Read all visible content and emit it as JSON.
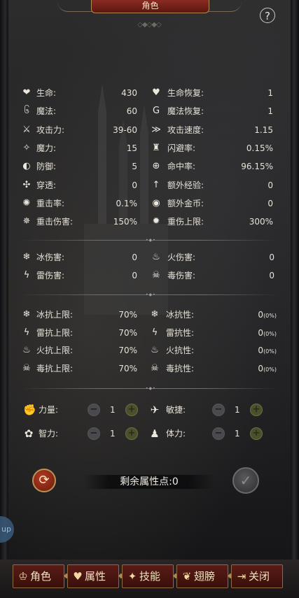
{
  "header": {
    "title": "角色",
    "help_icon": "?"
  },
  "stats": [
    {
      "icon": "heart-icon",
      "glyph": "❤",
      "label": "生命:",
      "value": "430"
    },
    {
      "icon": "life-regen-icon",
      "glyph": "♥",
      "label": "生命恢复:",
      "value": "1"
    },
    {
      "icon": "mana-swirl-icon",
      "glyph": "၆",
      "label": "魔法:",
      "value": "60"
    },
    {
      "icon": "mana-regen-icon",
      "glyph": "G",
      "label": "魔法恢复:",
      "value": "1"
    },
    {
      "icon": "sword-icon",
      "glyph": "⚔",
      "label": "攻击力:",
      "value": "39-60"
    },
    {
      "icon": "attack-speed-icon",
      "glyph": "≫",
      "label": "攻击速度:",
      "value": "1.15"
    },
    {
      "icon": "magic-power-icon",
      "glyph": "✧",
      "label": "魔力:",
      "value": "15"
    },
    {
      "icon": "dodge-icon",
      "glyph": "♜",
      "label": "闪避率:",
      "value": "0.15%"
    },
    {
      "icon": "shield-icon",
      "glyph": "◐",
      "label": "防御:",
      "value": "5"
    },
    {
      "icon": "crosshair-icon",
      "glyph": "⊕",
      "label": "命中率:",
      "value": "96.15%"
    },
    {
      "icon": "pierce-icon",
      "glyph": "✣",
      "label": "穿透:",
      "value": "0"
    },
    {
      "icon": "bonus-exp-icon",
      "glyph": "↑",
      "label": "额外经验:",
      "value": "0"
    },
    {
      "icon": "crit-rate-icon",
      "glyph": "✺",
      "label": "重击率:",
      "value": "0.1%"
    },
    {
      "icon": "bonus-gold-icon",
      "glyph": "◉",
      "label": "额外金币:",
      "value": "0"
    },
    {
      "icon": "crit-damage-icon",
      "glyph": "✵",
      "label": "重击伤害:",
      "value": "150%"
    },
    {
      "icon": "crit-cap-icon",
      "glyph": "✹",
      "label": "重伤上限:",
      "value": "300%"
    }
  ],
  "elemental_damage": [
    {
      "icon": "ice-icon",
      "glyph": "❄",
      "label": "冰伤害:",
      "value": "0"
    },
    {
      "icon": "fire-icon",
      "glyph": "♨",
      "label": "火伤害:",
      "value": "0"
    },
    {
      "icon": "lightning-icon",
      "glyph": "ϟ",
      "label": "雷伤害:",
      "value": "0"
    },
    {
      "icon": "poison-icon",
      "glyph": "☠",
      "label": "毒伤害:",
      "value": "0"
    }
  ],
  "resistances": [
    {
      "icon": "ice-cap-icon",
      "glyph": "❄",
      "label": "冰抗上限:",
      "value": "70%",
      "pct": ""
    },
    {
      "icon": "ice-resist-icon",
      "glyph": "❄",
      "label": "冰抗性:",
      "value": "0",
      "pct": "(0%)"
    },
    {
      "icon": "lightning-cap-icon",
      "glyph": "ϟ",
      "label": "雷抗上限:",
      "value": "70%",
      "pct": ""
    },
    {
      "icon": "lightning-resist-icon",
      "glyph": "ϟ",
      "label": "雷抗性:",
      "value": "0",
      "pct": "(0%)"
    },
    {
      "icon": "fire-cap-icon",
      "glyph": "♨",
      "label": "火抗上限:",
      "value": "70%",
      "pct": ""
    },
    {
      "icon": "fire-resist-icon",
      "glyph": "♨",
      "label": "火抗性:",
      "value": "0",
      "pct": "(0%)"
    },
    {
      "icon": "poison-cap-icon",
      "glyph": "☠",
      "label": "毒抗上限:",
      "value": "70%",
      "pct": ""
    },
    {
      "icon": "poison-resist-icon",
      "glyph": "☠",
      "label": "毒抗性:",
      "value": "0",
      "pct": "(0%)"
    }
  ],
  "attributes": [
    {
      "icon": "strength-icon",
      "glyph": "✊",
      "label": "力量:",
      "value": "1",
      "minus": "−",
      "plus": "+"
    },
    {
      "icon": "agility-icon",
      "glyph": "✈",
      "label": "敏捷:",
      "value": "1",
      "minus": "−",
      "plus": "+"
    },
    {
      "icon": "intellect-icon",
      "glyph": "✿",
      "label": "智力:",
      "value": "1",
      "minus": "−",
      "plus": "+"
    },
    {
      "icon": "stamina-icon",
      "glyph": "♟",
      "label": "体力:",
      "value": "1",
      "minus": "−",
      "plus": "+"
    }
  ],
  "actions": {
    "reset_glyph": "⟳",
    "remaining_points": "剩余属性点:0",
    "confirm_glyph": "✓",
    "side_badge": "up"
  },
  "tabs": [
    {
      "icon": "character-tab-icon",
      "glyph": "♔",
      "label": "角色"
    },
    {
      "icon": "attributes-tab-icon",
      "glyph": "♥",
      "label": "属性"
    },
    {
      "icon": "skills-tab-icon",
      "glyph": "✦",
      "label": "技能"
    },
    {
      "icon": "wings-tab-icon",
      "glyph": "❦",
      "label": "翅膀"
    },
    {
      "icon": "close-tab-icon",
      "glyph": "⇥",
      "label": "关闭"
    }
  ]
}
